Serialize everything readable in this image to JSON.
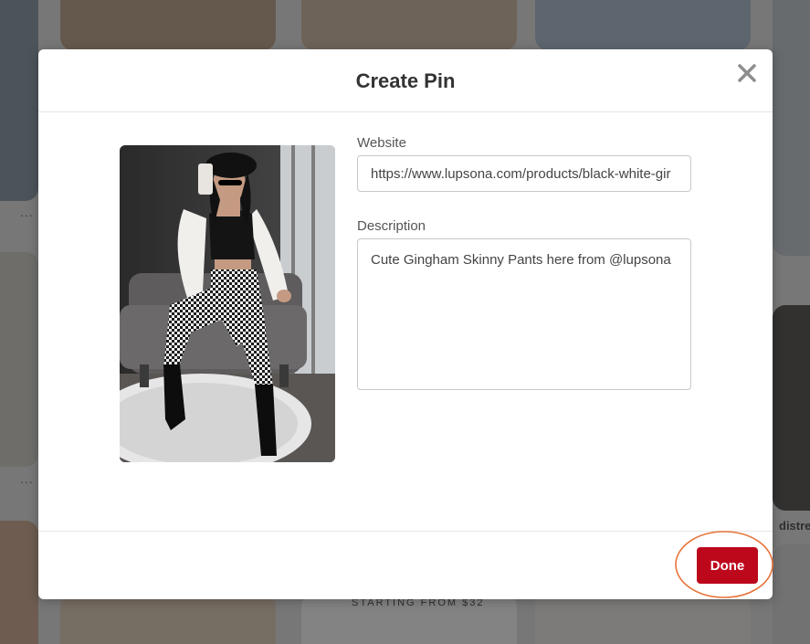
{
  "modal": {
    "title": "Create Pin",
    "close_icon": "close-icon",
    "website": {
      "label": "Website",
      "value": "https://www.lupsona.com/products/black-white-gir"
    },
    "description": {
      "label": "Description",
      "value": "Cute Gingham Skinny Pants here from @lupsona"
    },
    "done_label": "Done"
  },
  "background": {
    "caption": "distre",
    "promo": "STARTING FROM $32",
    "more_icon": "..."
  },
  "colors": {
    "brand_red": "#bd081c",
    "highlight_ring": "#e8733a"
  }
}
